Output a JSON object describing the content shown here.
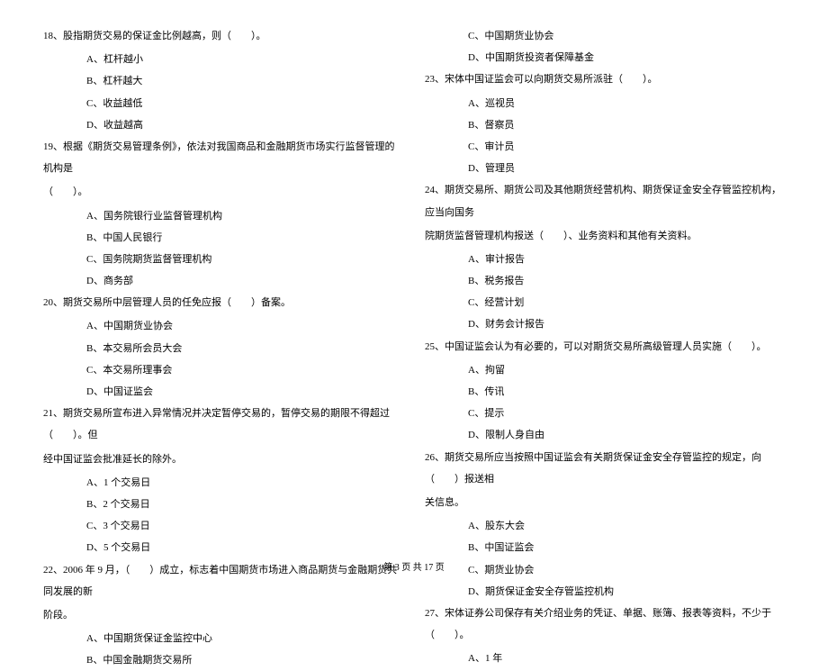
{
  "left": {
    "q18": {
      "stem": "18、股指期货交易的保证金比例越高，则（　　）。",
      "a": "A、杠杆越小",
      "b": "B、杠杆越大",
      "c": "C、收益越低",
      "d": "D、收益越高"
    },
    "q19": {
      "stem_line1": "19、根据《期货交易管理条例》，依法对我国商品和金融期货市场实行监督管理的机构是",
      "stem_line2": "（　　）。",
      "a": "A、国务院银行业监督管理机构",
      "b": "B、中国人民银行",
      "c": "C、国务院期货监督管理机构",
      "d": "D、商务部"
    },
    "q20": {
      "stem": "20、期货交易所中层管理人员的任免应报（　　）备案。",
      "a": "A、中国期货业协会",
      "b": "B、本交易所会员大会",
      "c": "C、本交易所理事会",
      "d": "D、中国证监会"
    },
    "q21": {
      "stem_line1": "21、期货交易所宣布进入异常情况并决定暂停交易的，暂停交易的期限不得超过（　　）。但",
      "stem_line2": "经中国证监会批准延长的除外。",
      "a": "A、1 个交易日",
      "b": "B、2 个交易日",
      "c": "C、3 个交易日",
      "d": "D、5 个交易日"
    },
    "q22": {
      "stem_line1": "22、2006 年 9 月，（　　）成立，标志着中国期货市场进入商品期货与金融期货共同发展的新",
      "stem_line2": "阶段。",
      "a": "A、中国期货保证金监控中心",
      "b": "B、中国金融期货交易所"
    }
  },
  "right": {
    "q22_cont": {
      "c": "C、中国期货业协会",
      "d": "D、中国期货投资者保障基金"
    },
    "q23": {
      "stem": "23、宋体中国证监会可以向期货交易所派驻（　　）。",
      "a": "A、巡视员",
      "b": "B、督察员",
      "c": "C、审计员",
      "d": "D、管理员"
    },
    "q24": {
      "stem_line1": "24、期货交易所、期货公司及其他期货经营机构、期货保证金安全存管监控机构，应当向国务",
      "stem_line2": "院期货监督管理机构报送（　　）、业务资料和其他有关资料。",
      "a": "A、审计报告",
      "b": "B、税务报告",
      "c": "C、经营计划",
      "d": "D、财务会计报告"
    },
    "q25": {
      "stem": "25、中国证监会认为有必要的，可以对期货交易所高级管理人员实施（　　）。",
      "a": "A、拘留",
      "b": "B、传讯",
      "c": "C、提示",
      "d": "D、限制人身自由"
    },
    "q26": {
      "stem_line1": "26、期货交易所应当按照中国证监会有关期货保证金安全存管监控的规定，向（　　）报送相",
      "stem_line2": "关信息。",
      "a": "A、股东大会",
      "b": "B、中国证监会",
      "c": "C、期货业协会",
      "d": "D、期货保证金安全存管监控机构"
    },
    "q27": {
      "stem": "27、宋体证券公司保存有关介绍业务的凭证、单据、账簿、报表等资料，不少于（　　）。",
      "a": "A、1 年"
    }
  },
  "footer": "第 3 页 共 17 页"
}
